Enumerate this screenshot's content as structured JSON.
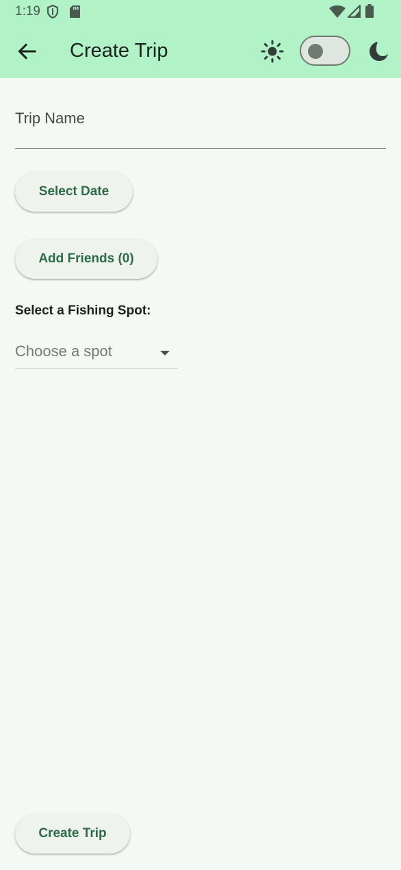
{
  "status_bar": {
    "time": "1:19",
    "icons": [
      "shield-icon",
      "sd-card-icon",
      "wifi-icon",
      "signal-icon",
      "battery-icon"
    ]
  },
  "app_bar": {
    "back_icon": "arrow-back-icon",
    "title": "Create Trip",
    "light_icon": "sun-icon",
    "dark_icon": "moon-icon",
    "theme_switch_on": false,
    "background_color": "#b1f2c7"
  },
  "form": {
    "trip_name": {
      "value": "",
      "placeholder": "Trip Name"
    },
    "select_date_label": "Select Date",
    "add_friends_label": "Add Friends (0)",
    "spot_label": "Select a Fishing Spot:",
    "spot_dropdown": {
      "value": "Choose a spot",
      "icon": "dropdown-arrow-icon"
    },
    "create_trip_label": "Create Trip"
  },
  "colors": {
    "page_background": "#f4faf3",
    "button_text": "#2c6b48"
  }
}
